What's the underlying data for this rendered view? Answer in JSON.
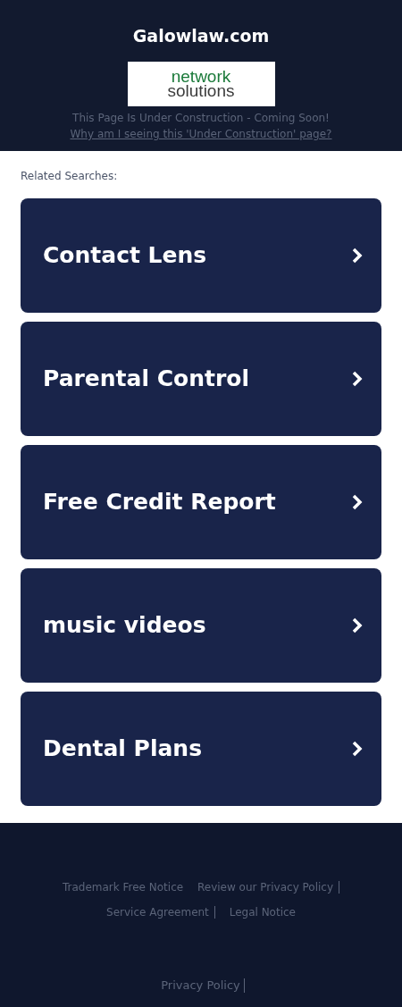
{
  "header": {
    "domain": "Galowlaw.com",
    "logo": {
      "line_1": "network",
      "line_2": "solutions"
    },
    "notice": "This Page Is Under Construction - Coming Soon!",
    "why_link": "Why am I seeing this 'Under Construction' page?"
  },
  "related": {
    "title": "Related Searches:",
    "items": [
      {
        "label": "Contact Lens"
      },
      {
        "label": "Parental Control"
      },
      {
        "label": "Free Credit Report"
      },
      {
        "label": "music videos"
      },
      {
        "label": "Dental Plans"
      }
    ]
  },
  "footer": {
    "links": [
      {
        "label": "Trademark Free Notice",
        "divider": false
      },
      {
        "label": "Review our Privacy Policy",
        "divider": true
      },
      {
        "label": "Service Agreement",
        "divider": true
      },
      {
        "label": "Legal Notice",
        "divider": false
      }
    ],
    "bottom_links": [
      {
        "label": "Privacy Policy",
        "divider": true
      }
    ]
  }
}
